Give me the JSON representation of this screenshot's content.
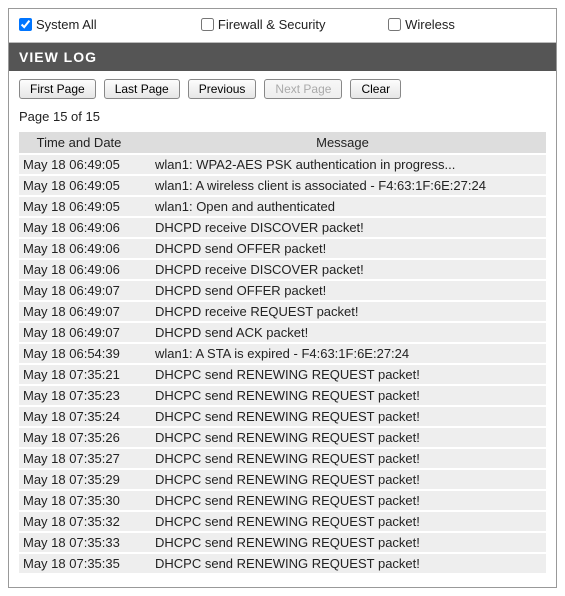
{
  "filters": [
    {
      "label": "System All",
      "checked": true
    },
    {
      "label": "Firewall & Security",
      "checked": false
    },
    {
      "label": "Wireless",
      "checked": false
    }
  ],
  "section_title": "VIEW LOG",
  "buttons": {
    "first_page": "First Page",
    "last_page": "Last Page",
    "previous": "Previous",
    "next_page": "Next Page",
    "clear": "Clear"
  },
  "page_indicator": "Page 15 of 15",
  "table": {
    "headers": {
      "datetime": "Time and Date",
      "message": "Message"
    },
    "rows": [
      {
        "datetime": "May 18 06:49:05",
        "message": "wlan1: WPA2-AES PSK authentication in progress..."
      },
      {
        "datetime": "May 18 06:49:05",
        "message": "wlan1: A wireless client is associated - F4:63:1F:6E:27:24"
      },
      {
        "datetime": "May 18 06:49:05",
        "message": "wlan1: Open and authenticated"
      },
      {
        "datetime": "May 18 06:49:06",
        "message": "DHCPD receive DISCOVER packet!"
      },
      {
        "datetime": "May 18 06:49:06",
        "message": "DHCPD send OFFER packet!"
      },
      {
        "datetime": "May 18 06:49:06",
        "message": "DHCPD receive DISCOVER packet!"
      },
      {
        "datetime": "May 18 06:49:07",
        "message": "DHCPD send OFFER packet!"
      },
      {
        "datetime": "May 18 06:49:07",
        "message": "DHCPD receive REQUEST packet!"
      },
      {
        "datetime": "May 18 06:49:07",
        "message": "DHCPD send ACK packet!"
      },
      {
        "datetime": "May 18 06:54:39",
        "message": "wlan1: A STA is expired - F4:63:1F:6E:27:24"
      },
      {
        "datetime": "May 18 07:35:21",
        "message": "DHCPC send RENEWING REQUEST packet!"
      },
      {
        "datetime": "May 18 07:35:23",
        "message": "DHCPC send RENEWING REQUEST packet!"
      },
      {
        "datetime": "May 18 07:35:24",
        "message": "DHCPC send RENEWING REQUEST packet!"
      },
      {
        "datetime": "May 18 07:35:26",
        "message": "DHCPC send RENEWING REQUEST packet!"
      },
      {
        "datetime": "May 18 07:35:27",
        "message": "DHCPC send RENEWING REQUEST packet!"
      },
      {
        "datetime": "May 18 07:35:29",
        "message": "DHCPC send RENEWING REQUEST packet!"
      },
      {
        "datetime": "May 18 07:35:30",
        "message": "DHCPC send RENEWING REQUEST packet!"
      },
      {
        "datetime": "May 18 07:35:32",
        "message": "DHCPC send RENEWING REQUEST packet!"
      },
      {
        "datetime": "May 18 07:35:33",
        "message": "DHCPC send RENEWING REQUEST packet!"
      },
      {
        "datetime": "May 18 07:35:35",
        "message": "DHCPC send RENEWING REQUEST packet!"
      }
    ]
  }
}
